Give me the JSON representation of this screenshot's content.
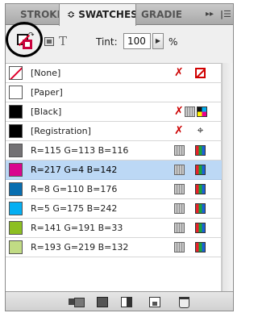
{
  "tabs": [
    {
      "label": "STROKE"
    },
    {
      "label": "≎ SWATCHES"
    },
    {
      "label": "GRADIENT"
    }
  ],
  "tab_controls": {
    "collapse": "▸▸",
    "menu": "|☰"
  },
  "controls": {
    "tint_label": "Tint:",
    "tint_value": "100",
    "tint_arrow": "▶",
    "tint_unit": "%"
  },
  "swatches": [
    {
      "name": "[None]",
      "chip": "none"
    },
    {
      "name": "[Paper]",
      "chip": "#ffffff"
    },
    {
      "name": "[Black]",
      "chip": "#000000"
    },
    {
      "name": "[Registration]",
      "chip": "#000000"
    },
    {
      "name": "R=115 G=113 B=116",
      "chip": "#737174"
    },
    {
      "name": "R=217 G=4 B=142",
      "chip": "#d9048e",
      "selected": true
    },
    {
      "name": "R=8 G=110 B=176",
      "chip": "#086eb0"
    },
    {
      "name": "R=5 G=175 B=242",
      "chip": "#05aff2"
    },
    {
      "name": "R=141 G=191 B=33",
      "chip": "#8dbf21"
    },
    {
      "name": "R=193 G=219 B=132",
      "chip": "#c1db84"
    }
  ],
  "colors": {
    "selection": "#bcd8f5",
    "none_stroke": "#e0002c",
    "annotation": "#000000"
  }
}
